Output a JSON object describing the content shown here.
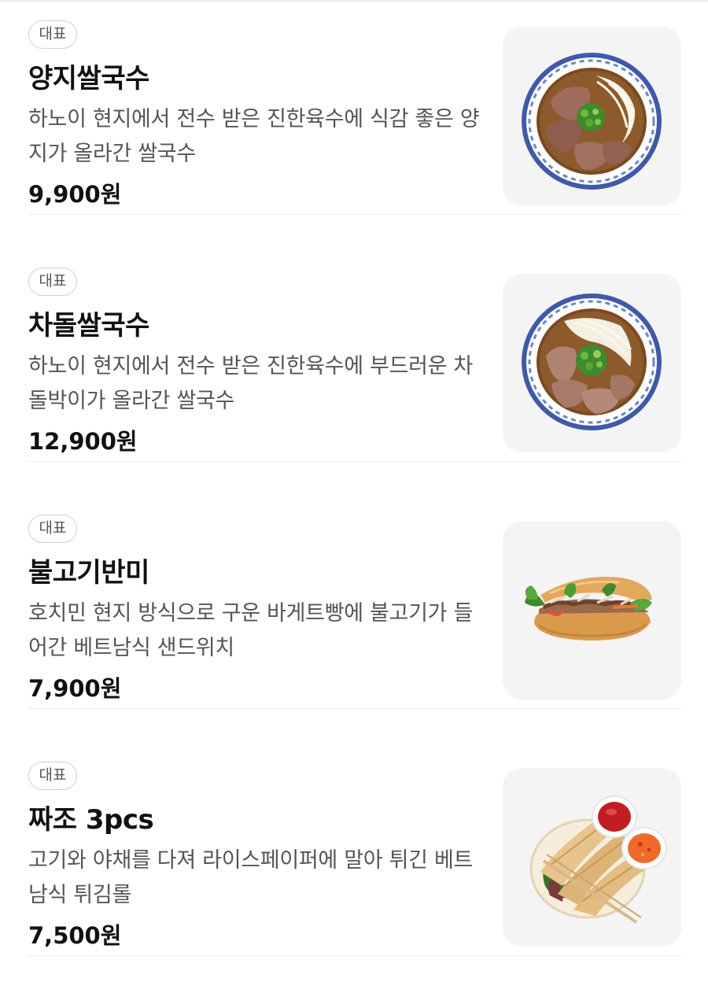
{
  "menu": {
    "items": [
      {
        "badge": "대표",
        "name": "양지쌀국수",
        "description": "하노이 현지에서 전수 받은 진한육수에 식감 좋은 양지가 올라간 쌀국수",
        "price": "9,900원",
        "image": "pho-brisket-image"
      },
      {
        "badge": "대표",
        "name": "차돌쌀국수",
        "description": "하노이 현지에서 전수 받은 진한육수에 부드러운 차돌박이가 올라간 쌀국수",
        "price": "12,900원",
        "image": "pho-chadol-image"
      },
      {
        "badge": "대표",
        "name": "불고기반미",
        "description": "호치민 현지 방식으로 구운 바게트빵에 불고기가 들어간 베트남식 샌드위치",
        "price": "7,900원",
        "image": "bulgogi-banhmi-image"
      },
      {
        "badge": "대표",
        "name": "짜조 3pcs",
        "description": "고기와 야채를 다져 라이스페이퍼에 말아 튀긴 베트남식 튀김롤",
        "price": "7,500원",
        "image": "cha-gio-image"
      }
    ]
  },
  "colors": {
    "background": "#ffffff",
    "thumb_bg": "#f4f4f5",
    "text_primary": "#111111",
    "text_secondary": "#555555",
    "divider": "#ebebeb",
    "badge_border": "#d0d0d0"
  }
}
